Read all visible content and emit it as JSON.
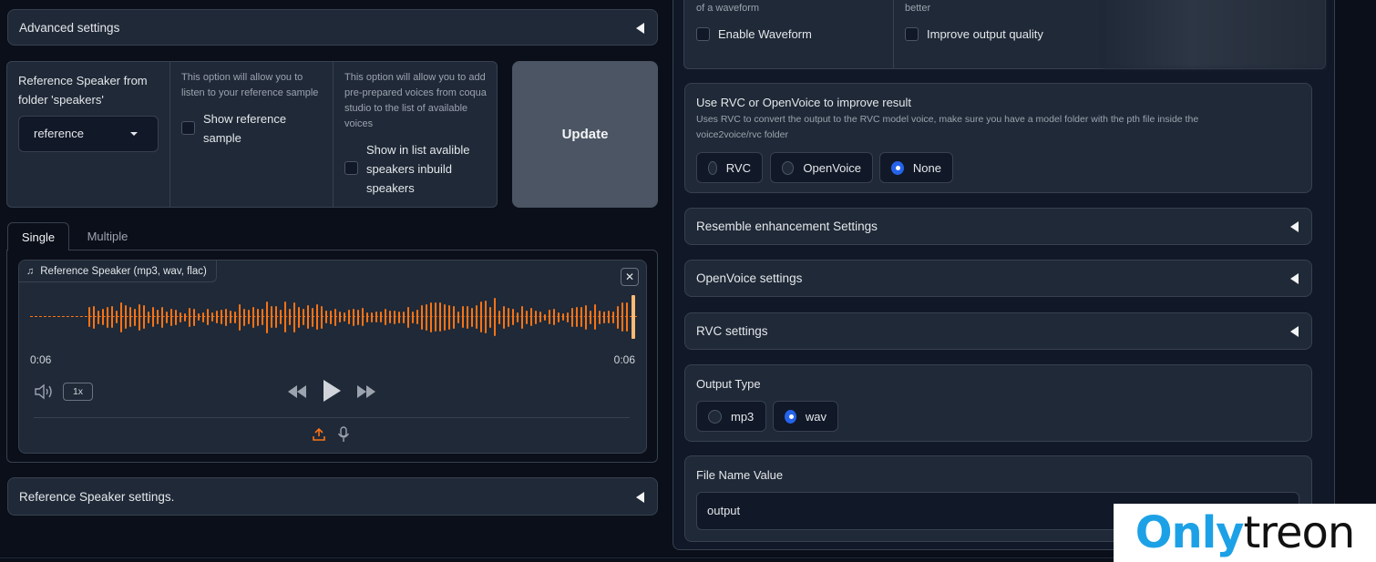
{
  "left": {
    "advanced_settings": "Advanced settings",
    "reference_speaker": {
      "label": "Reference Speaker from folder 'speakers'",
      "selected": "reference"
    },
    "show_reference": {
      "desc": "This option will allow you to listen to your reference sample",
      "label": "Show reference sample"
    },
    "show_in_list": {
      "desc": "This option will allow you to add pre-prepared voices from coqua studio to the list of available voices",
      "label": "Show in list avalible speakers inbuild speakers"
    },
    "update_button": "Update",
    "tabs": [
      "Single",
      "Multiple"
    ],
    "audio": {
      "label": "Reference Speaker (mp3, wav, flac)",
      "time_start": "0:06",
      "time_end": "0:06",
      "speed": "1x",
      "wave_color": "#f97316"
    },
    "reference_settings": "Reference Speaker settings."
  },
  "right": {
    "top_desc_left": "of a waveform",
    "top_desc_right": "better",
    "enable_waveform": "Enable Waveform",
    "improve_quality": "Improve output quality",
    "rvc_block": {
      "title": "Use RVC or OpenVoice to improve result",
      "desc": "Uses RVC to convert the output to the RVC model voice, make sure you have a model folder with the pth file inside the voice2voice/rvc folder",
      "options": [
        "RVC",
        "OpenVoice",
        "None"
      ],
      "selected": "None"
    },
    "resemble": "Resemble enhancement Settings",
    "openvoice": "OpenVoice settings",
    "rvc": "RVC settings",
    "output_type": {
      "title": "Output Type",
      "options": [
        "mp3",
        "wav"
      ],
      "selected": "wav"
    },
    "file_name": {
      "title": "File Name Value",
      "value": "output"
    }
  },
  "watermark": {
    "part1": "Only",
    "part2": "treon",
    "color1": "#1da1e6",
    "color2": "#111111"
  }
}
